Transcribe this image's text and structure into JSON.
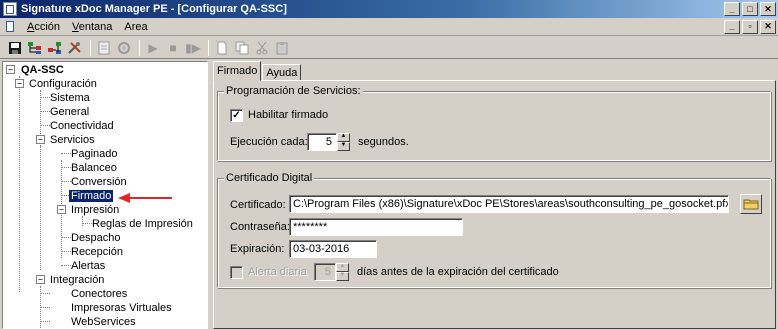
{
  "window": {
    "title": "Signature xDoc Manager PE - [Configurar QA-SSC]"
  },
  "menu": {
    "items": [
      {
        "label": "Acción",
        "u": "A",
        "rest": "cción"
      },
      {
        "label": "Ventana",
        "u": "V",
        "rest": "entana"
      },
      {
        "label": "Area",
        "u": "A",
        "rest": "rea",
        "prefix": ""
      }
    ]
  },
  "toolbar": {
    "icons": [
      "save-icon",
      "tree-add-icon",
      "tree-remove-icon",
      "tools-icon",
      "properties-icon",
      "settings-icon",
      "play-icon",
      "stop-icon",
      "step-icon",
      "document-icon",
      "copy-icon",
      "cut-icon",
      "paste-icon"
    ]
  },
  "tree": {
    "root": "QA-SSC",
    "configuracion": "Configuración",
    "sistema": "Sistema",
    "general": "General",
    "conectividad": "Conectividad",
    "servicios": "Servicios",
    "paginado": "Paginado",
    "balanceo": "Balanceo",
    "conversion": "Conversión",
    "firmado": "Firmado",
    "impresion": "Impresión",
    "reglas": "Reglas de Impresión",
    "despacho": "Despacho",
    "recepcion": "Recepción",
    "alertas": "Alertas",
    "integracion": "Integración",
    "conectores": "Conectores",
    "impresoras": "Impresoras Virtuales",
    "webservices": "WebServices"
  },
  "tabs": {
    "firmado": "Firmado",
    "ayuda": "Ayuda"
  },
  "programacion": {
    "legend": "Programación de Servicios:",
    "habilitar_label": "Habilitar firmado",
    "habilitar_checked": true,
    "ejecucion_label": "Ejecución cada:",
    "ejecucion_value": "5",
    "ejecucion_unit": "segundos."
  },
  "certificado": {
    "legend": "Certificado Digital",
    "cert_label": "Certificado:",
    "cert_value": "C:\\Program Files (x86)\\Signature\\xDoc PE\\Stores\\areas\\southconsulting_pe_gosocket.pfx",
    "pass_label": "Contraseña:",
    "pass_value": "********",
    "exp_label": "Expiración:",
    "exp_value": "03-03-2016",
    "alerta_label": "Alerta diaria",
    "alerta_value": "5",
    "alerta_suffix": "días antes de la expiración del certificado"
  },
  "colors": {
    "selection": "#0a246a",
    "arrow": "#e0252b",
    "titlebar": "#0a246a"
  }
}
